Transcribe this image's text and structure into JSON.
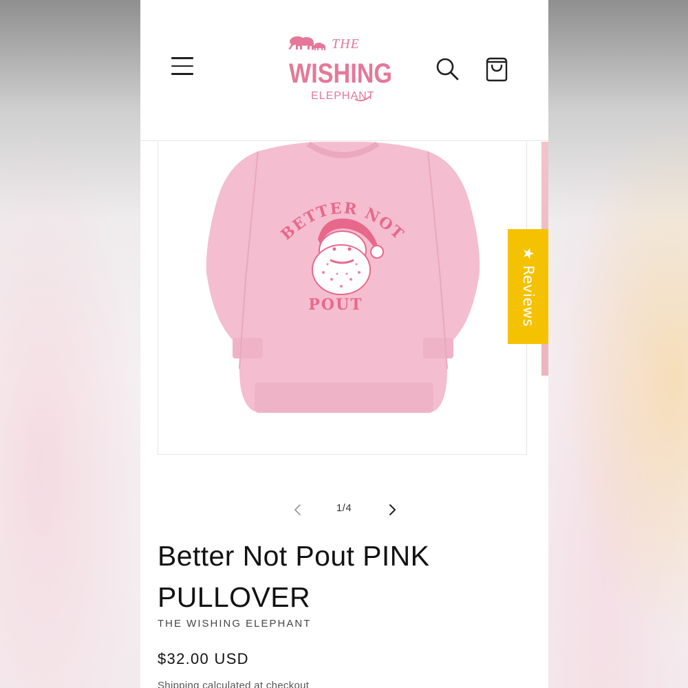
{
  "header": {
    "menu_icon": "hamburger-menu-icon",
    "logo": {
      "line1": "THE",
      "line2": "WISHING",
      "line3": "ELEPHANT",
      "color": "#e5789a"
    },
    "search_icon": "search-icon",
    "cart_icon": "cart-icon"
  },
  "gallery": {
    "image": {
      "garment_color": "#f4bdd0",
      "print_color": "#e8688b",
      "print_text_top": "BETTER NOT",
      "print_text_bottom": "POUT"
    },
    "pager": {
      "current": "1/4",
      "prev_icon": "chevron-left-icon",
      "next_icon": "chevron-right-icon"
    }
  },
  "reviews_tab": {
    "star": "★",
    "label": "Reviews",
    "color": "#f4c200"
  },
  "product": {
    "title": "Better Not Pout PINK PULLOVER",
    "vendor": "THE WISHING ELEPHANT",
    "price": "$32.00 USD",
    "shipping_note": "Shipping calculated at checkout"
  }
}
